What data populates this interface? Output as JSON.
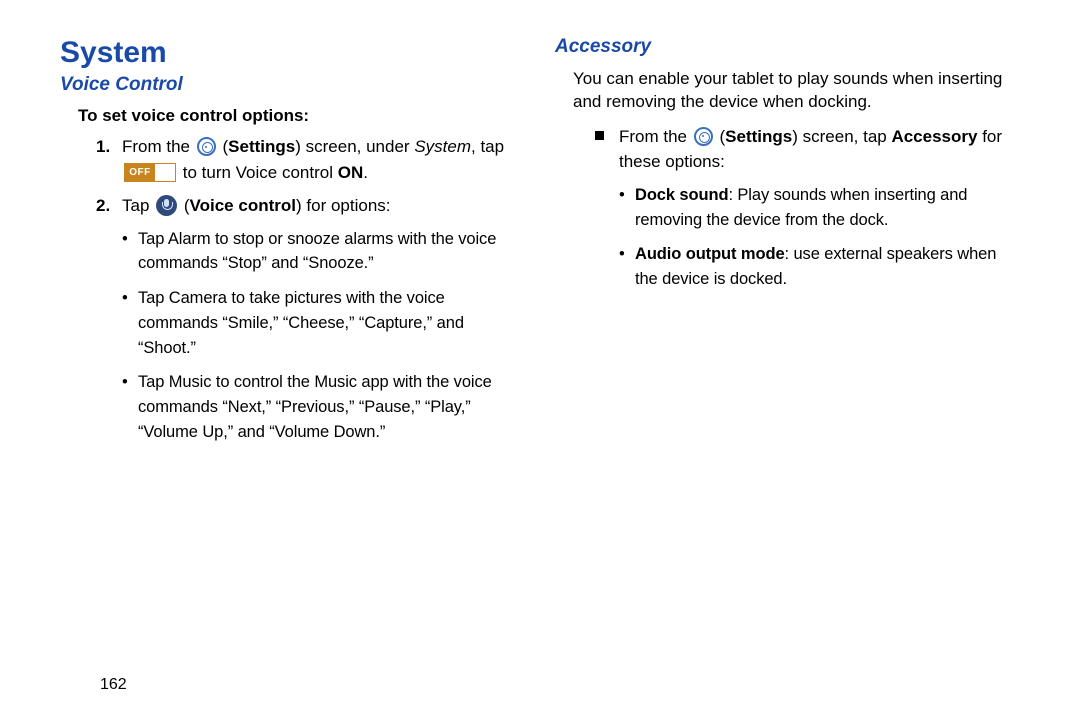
{
  "pageNumber": "162",
  "left": {
    "h1": "System",
    "h2": "Voice Control",
    "subhead": "To set voice control options:",
    "step1": {
      "num": "1.",
      "pre": "From the ",
      "settingsOpen": "(",
      "settingsWord": "Settings",
      "settingsClose": ")",
      "mid": " screen, under ",
      "systemWord": "System",
      "afterSystem": ", tap ",
      "offLabel": "OFF",
      "tail1": " to turn Voice control ",
      "onWord": "ON",
      "period": "."
    },
    "step2": {
      "num": "2.",
      "pre": "Tap ",
      "open": "(",
      "vcWord": "Voice control",
      "close": ")",
      "post": " for options:"
    },
    "bullets": [
      "Tap Alarm to stop or snooze alarms with the voice commands “Stop” and “Snooze.”",
      "Tap Camera to take pictures with the voice commands “Smile,” “Cheese,” “Capture,” and “Shoot.”",
      "Tap Music to control the Music app with the voice commands “Next,” “Previous,” “Pause,” “Play,” “Volume Up,” and “Volume Down.”"
    ]
  },
  "right": {
    "h2": "Accessory",
    "intro": "You can enable your tablet to play sounds when inserting and removing the device when docking.",
    "sq": {
      "pre": "From the ",
      "open": "(",
      "settingsWord": "Settings",
      "close": ")",
      "mid": " screen, tap ",
      "accWord": "Accessory",
      "post": " for these options:"
    },
    "bullets": [
      {
        "head": "Dock sound",
        "tail": ": Play sounds when inserting and removing the device from the dock."
      },
      {
        "head": "Audio output mode",
        "tail": ": use external speakers when the device is docked."
      }
    ]
  }
}
